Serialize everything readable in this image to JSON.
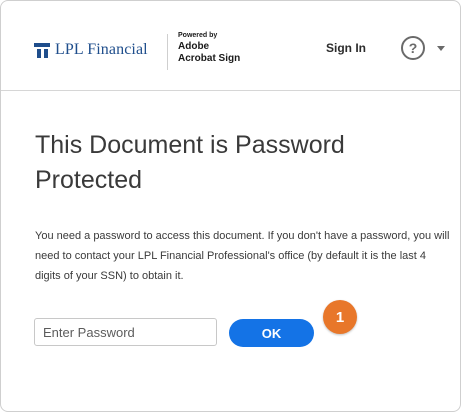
{
  "header": {
    "logo_text": "LPL Financial",
    "powered_by": "Powered by",
    "adobe": "Adobe",
    "acrobat_sign": "Acrobat Sign",
    "sign_in_label": "Sign In",
    "help_icon_glyph": "?"
  },
  "main": {
    "title": "This Document is Password Protected",
    "description": "You need a password to access this document. If you don't have a password, you will need to contact your LPL Financial Professional's office (by default it is the last 4 digits of your SSN) to obtain it.",
    "password_placeholder": "Enter Password",
    "password_value": "",
    "ok_label": "OK"
  },
  "annotation": {
    "step_number": "1"
  },
  "colors": {
    "brand_blue": "#1f4e8c",
    "button_blue": "#1473e6",
    "badge_orange": "#e8772a"
  }
}
